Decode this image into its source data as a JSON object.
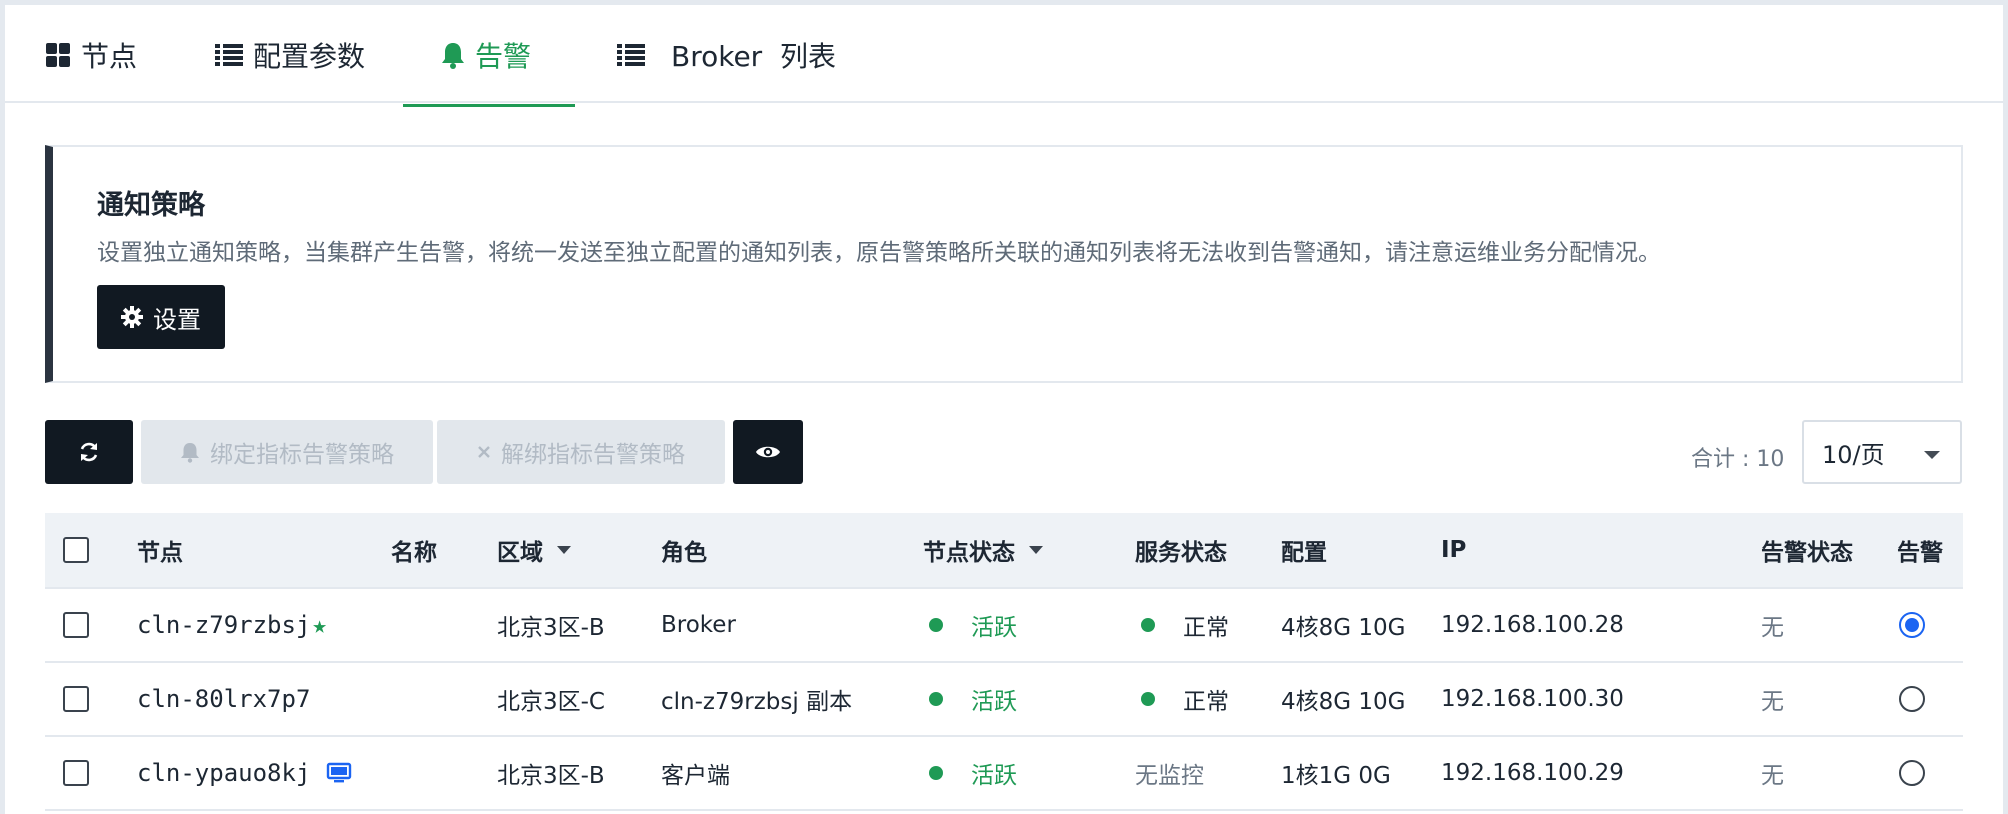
{
  "tabs": [
    {
      "label": "节点",
      "icon": "grid-icon",
      "active": false
    },
    {
      "label": "配置参数",
      "icon": "list-icon",
      "active": false
    },
    {
      "label": "告警",
      "icon": "bell-icon",
      "active": true
    },
    {
      "label": "Broker  列表",
      "icon": "list-icon",
      "active": false
    }
  ],
  "notice": {
    "title": "通知策略",
    "description": "设置独立通知策略，当集群产生告警，将统一发送至独立配置的通知列表，原告警策略所关联的通知列表将无法收到告警通知，请注意运维业务分配情况。",
    "button_label": "设置"
  },
  "toolbar": {
    "bind_label": "绑定指标告警策略",
    "unbind_label": "解绑指标告警策略",
    "total_text": "合计 : 10",
    "page_size": "10/页"
  },
  "table": {
    "headers": {
      "node": "节点",
      "name": "名称",
      "zone": "区域",
      "role": "角色",
      "node_status": "节点状态",
      "service_status": "服务状态",
      "config": "配置",
      "ip": "IP",
      "alarm_status": "告警状态",
      "alarm": "告警"
    },
    "rows": [
      {
        "node": "cln-z79rzbsj",
        "badge": "star",
        "name": "",
        "zone": "北京3区-B",
        "role": "Broker",
        "node_status": "活跃",
        "service_status": "正常",
        "service_dot": true,
        "config": "4核8G 10G",
        "ip": "192.168.100.28",
        "alarm_status": "无",
        "selected": true
      },
      {
        "node": "cln-80lrx7p7",
        "badge": "",
        "name": "",
        "zone": "北京3区-C",
        "role": "cln-z79rzbsj 副本",
        "node_status": "活跃",
        "service_status": "正常",
        "service_dot": true,
        "config": "4核8G 10G",
        "ip": "192.168.100.30",
        "alarm_status": "无",
        "selected": false
      },
      {
        "node": "cln-ypauo8kj",
        "badge": "monitor",
        "name": "",
        "zone": "北京3区-B",
        "role": "客户端",
        "node_status": "活跃",
        "service_status": "无监控",
        "service_dot": false,
        "config": "1核1G 0G",
        "ip": "192.168.100.29",
        "alarm_status": "无",
        "selected": false
      }
    ]
  },
  "colors": {
    "accent_green": "#1f9a55",
    "dark_button": "#111922",
    "radio_blue": "#1b64f2"
  }
}
